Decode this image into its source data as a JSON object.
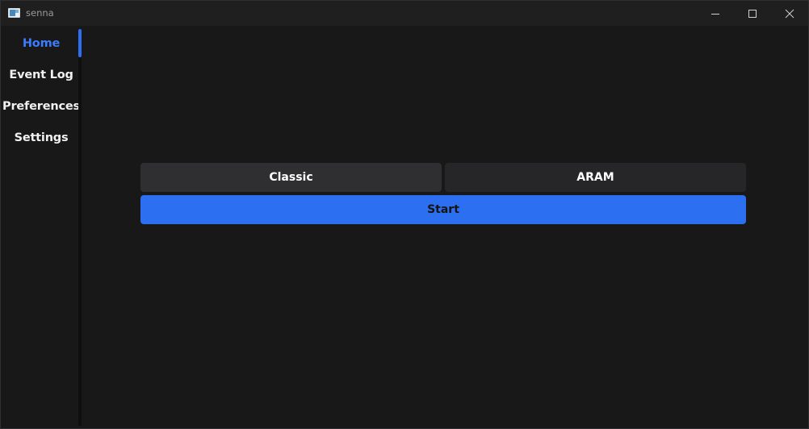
{
  "window": {
    "title": "senna",
    "icon": "app-window-icon",
    "controls": [
      "minimize-icon",
      "maximize-icon",
      "close-icon"
    ]
  },
  "sidebar": {
    "items": [
      {
        "label": "Home",
        "active": true
      },
      {
        "label": "Event Log",
        "active": false
      },
      {
        "label": "Preferences",
        "active": false
      },
      {
        "label": "Settings",
        "active": false
      }
    ]
  },
  "main": {
    "mode_buttons": [
      {
        "label": "Classic"
      },
      {
        "label": "ARAM"
      }
    ],
    "start_label": "Start"
  },
  "colors": {
    "accent": "#2c6ff0",
    "active_nav": "#3b7cff",
    "background": "#181818"
  }
}
